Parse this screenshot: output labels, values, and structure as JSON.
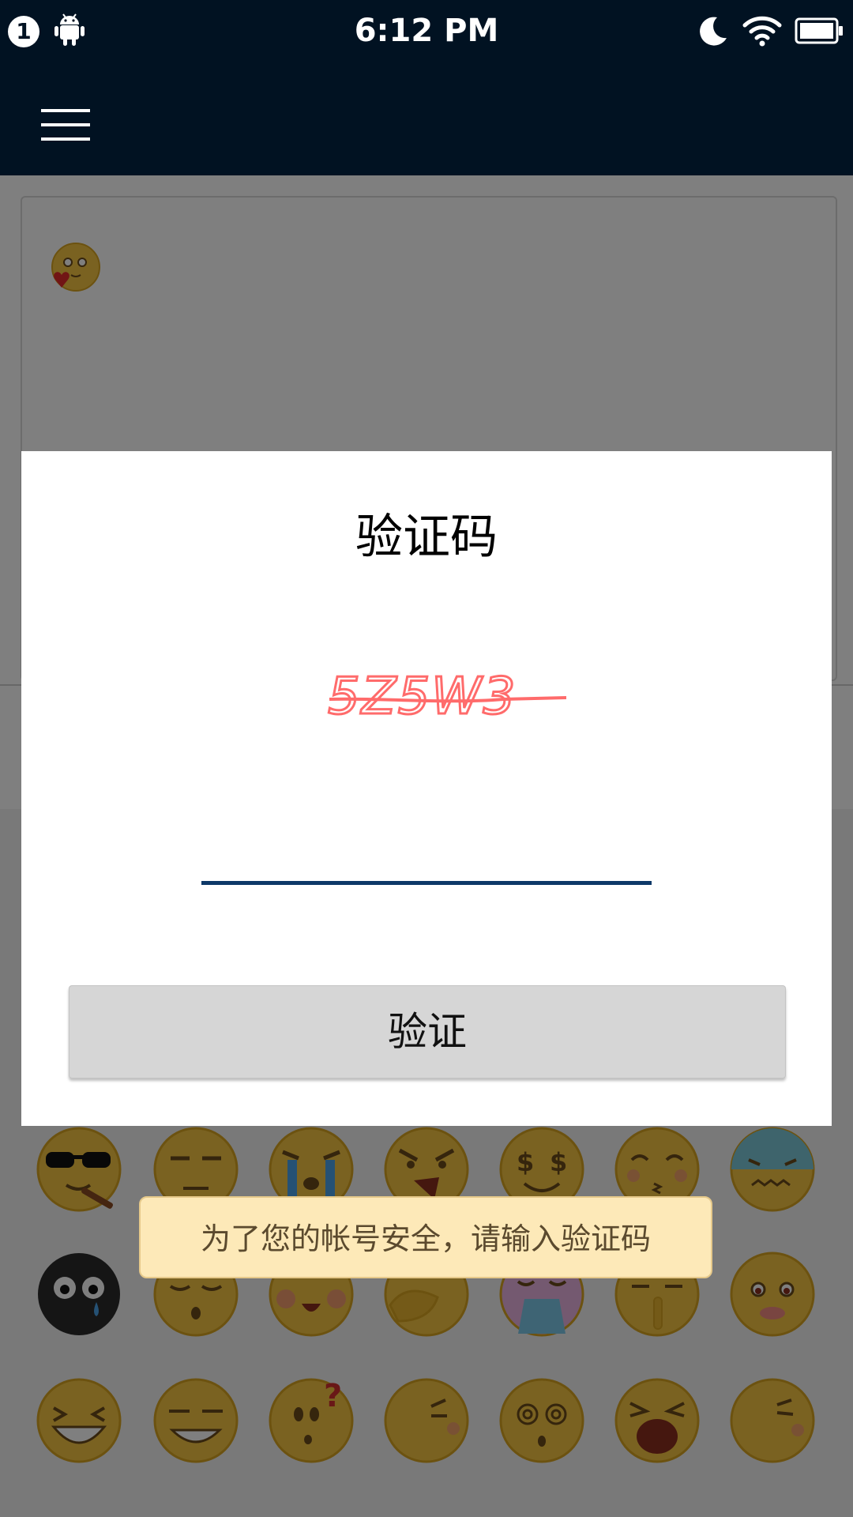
{
  "status_bar": {
    "notification_count": "1",
    "time": "6:12 PM",
    "icons": [
      "android-icon",
      "moon-icon",
      "wifi-icon",
      "battery-icon"
    ]
  },
  "app_bar": {
    "menu_icon": "hamburger-menu-icon",
    "background_color": "#011222"
  },
  "dialog": {
    "title": "验证码",
    "captcha_text": "5Z5W3",
    "input_value": "",
    "verify_button_label": "验证",
    "input_underline_color": "#0d3868"
  },
  "toast": {
    "message": "为了您的帐号安全，请输入验证码"
  },
  "emoji_panel": {
    "icons": [
      "cool-sunglasses-cigar-emoji",
      "smug-emoji",
      "crying-emoji",
      "angry-shouting-emoji",
      "money-eyes-emoji",
      "kissing-emoji",
      "cold-sweat-emoji",
      "black-ghost-emoji",
      "sleepy-emoji",
      "happy-blush-emoji",
      "facepalm-emoji",
      "vomiting-emoji",
      "shush-emoji",
      "shy-emoji",
      "big-grin-emoji",
      "sly-grin-emoji",
      "question-emoji",
      "thinking-emoji",
      "dizzy-emoji",
      "yawning-emoji",
      "wink-emoji"
    ]
  }
}
